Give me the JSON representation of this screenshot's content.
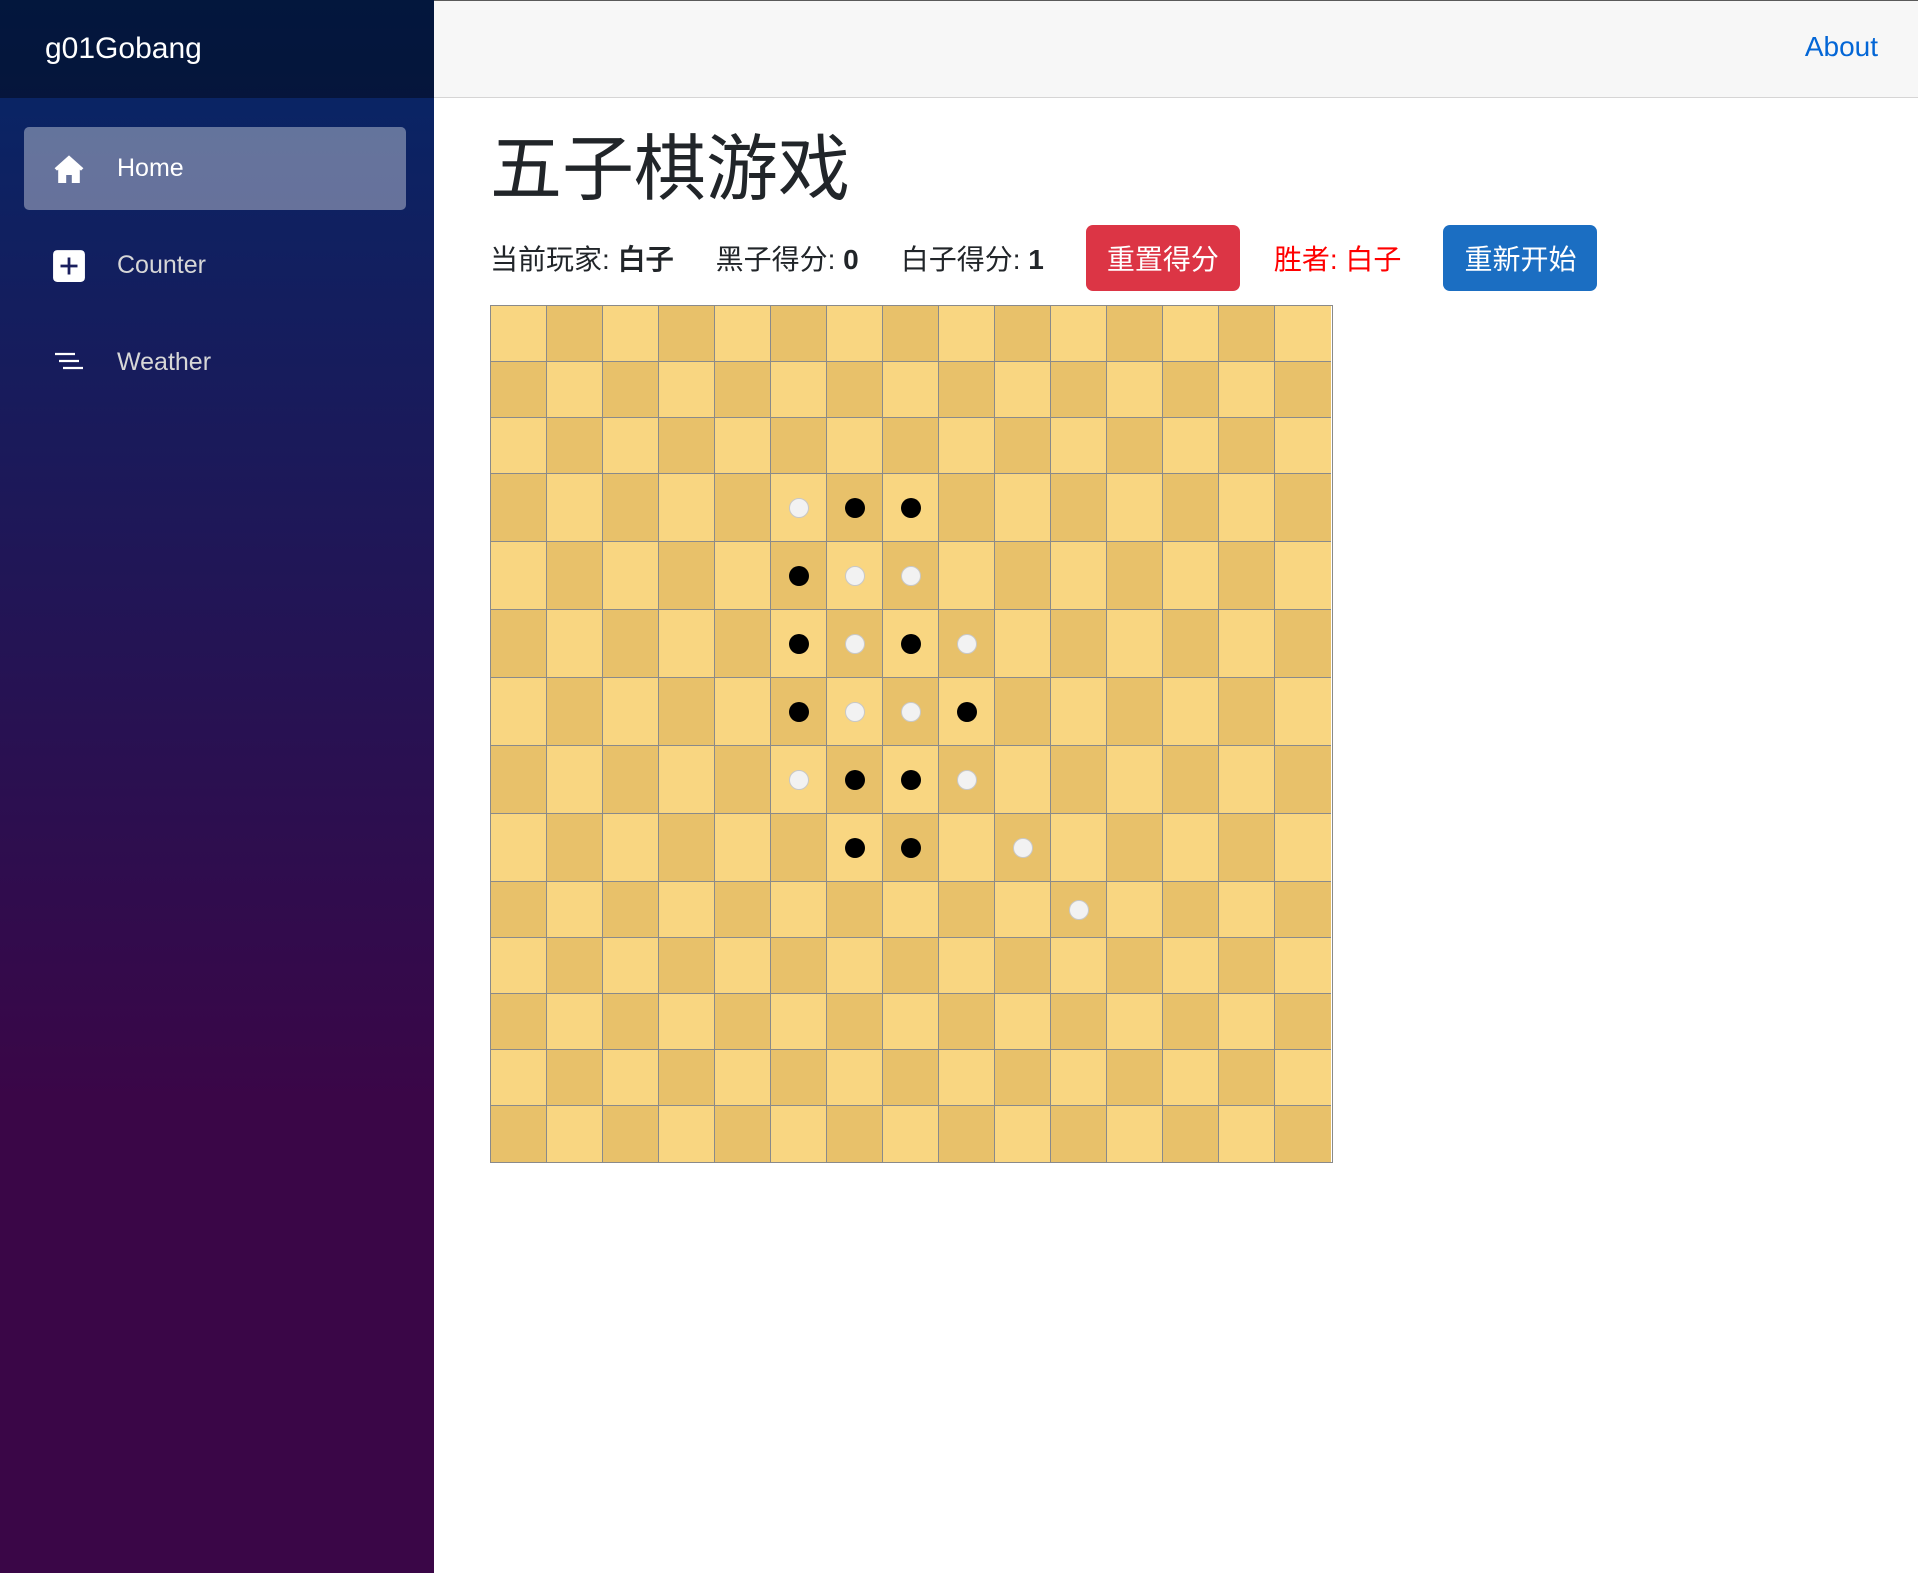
{
  "brand": "g01Gobang",
  "nav": [
    {
      "label": "Home",
      "icon": "home-icon",
      "active": true
    },
    {
      "label": "Counter",
      "icon": "plus-square-icon",
      "active": false
    },
    {
      "label": "Weather",
      "icon": "list-icon",
      "active": false
    }
  ],
  "topbar": {
    "about": "About"
  },
  "main": {
    "title": "五子棋游戏",
    "current_player_label": "当前玩家:",
    "current_player": "白子",
    "black_score_label": "黑子得分:",
    "black_score": "0",
    "white_score_label": "白子得分:",
    "white_score": "1",
    "reset_score_button": "重置得分",
    "winner_text": "胜者: 白子",
    "restart_button": "重新开始"
  },
  "board": {
    "size": 15,
    "rows": 14,
    "stones": [
      {
        "row": 3,
        "col": 5,
        "color": "white"
      },
      {
        "row": 3,
        "col": 6,
        "color": "black"
      },
      {
        "row": 3,
        "col": 7,
        "color": "black"
      },
      {
        "row": 4,
        "col": 5,
        "color": "black"
      },
      {
        "row": 4,
        "col": 6,
        "color": "white"
      },
      {
        "row": 4,
        "col": 7,
        "color": "white"
      },
      {
        "row": 5,
        "col": 5,
        "color": "black"
      },
      {
        "row": 5,
        "col": 6,
        "color": "white"
      },
      {
        "row": 5,
        "col": 7,
        "color": "black"
      },
      {
        "row": 5,
        "col": 8,
        "color": "white"
      },
      {
        "row": 6,
        "col": 5,
        "color": "black"
      },
      {
        "row": 6,
        "col": 6,
        "color": "white"
      },
      {
        "row": 6,
        "col": 7,
        "color": "white"
      },
      {
        "row": 6,
        "col": 8,
        "color": "black"
      },
      {
        "row": 7,
        "col": 5,
        "color": "white"
      },
      {
        "row": 7,
        "col": 6,
        "color": "black"
      },
      {
        "row": 7,
        "col": 7,
        "color": "black"
      },
      {
        "row": 7,
        "col": 8,
        "color": "white"
      },
      {
        "row": 8,
        "col": 6,
        "color": "black"
      },
      {
        "row": 8,
        "col": 7,
        "color": "black"
      },
      {
        "row": 8,
        "col": 9,
        "color": "white"
      },
      {
        "row": 9,
        "col": 10,
        "color": "white"
      }
    ],
    "colors": {
      "light": "#f9d681",
      "dark": "#e8c16a",
      "black_stone": "#000000",
      "white_stone": "#f2f2f2"
    }
  }
}
